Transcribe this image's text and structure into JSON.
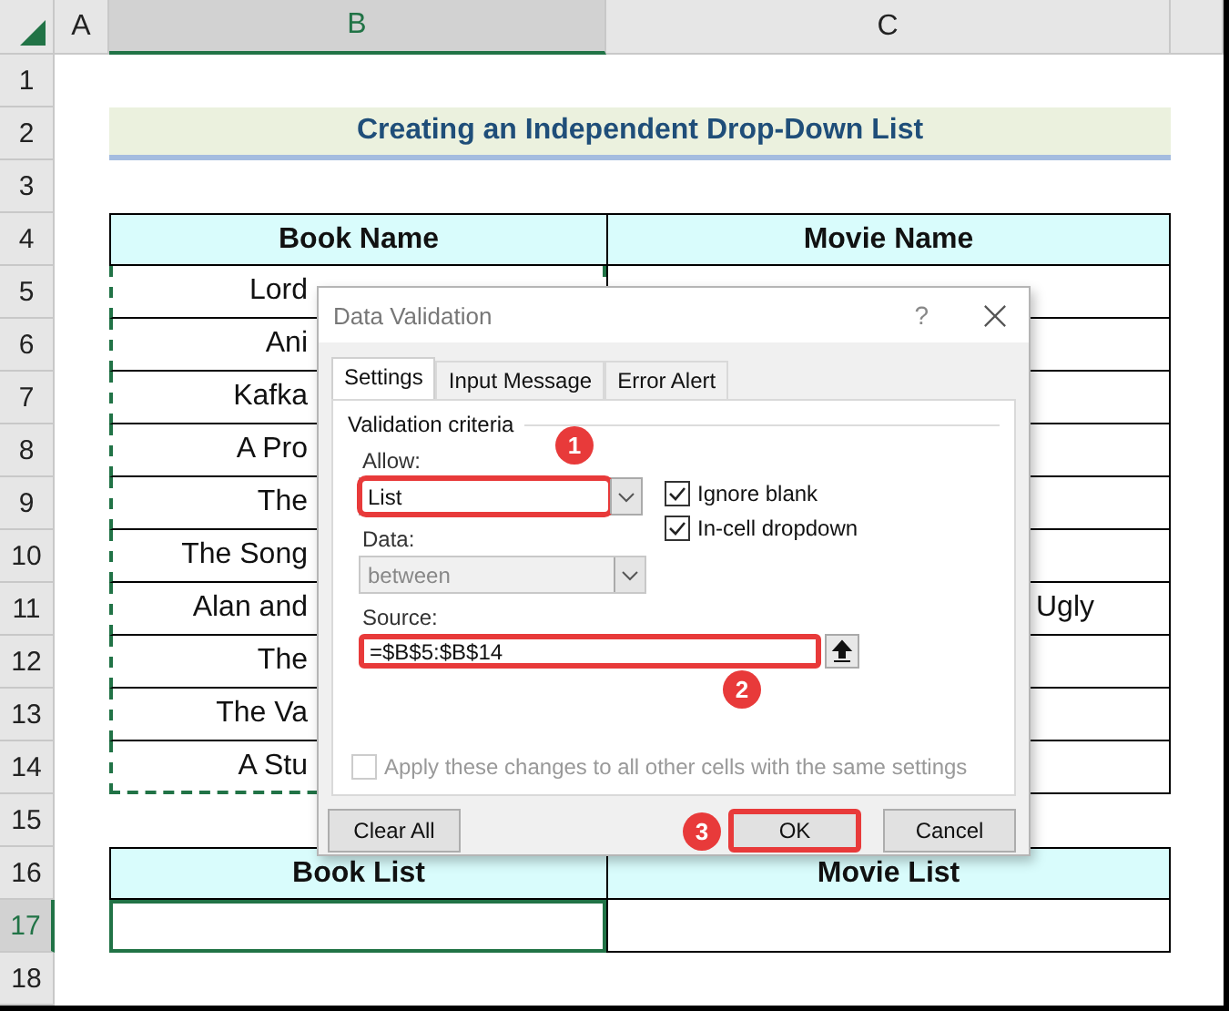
{
  "columns": [
    {
      "label": "A",
      "selected": false
    },
    {
      "label": "B",
      "selected": true
    },
    {
      "label": "C",
      "selected": false
    }
  ],
  "rows": [
    {
      "number": "1",
      "selected": false,
      "kind": "blank"
    },
    {
      "number": "2",
      "selected": false,
      "kind": "title",
      "text": "Creating an Independent Drop-Down List"
    },
    {
      "number": "3",
      "selected": false,
      "kind": "blank"
    },
    {
      "number": "4",
      "selected": false,
      "kind": "header",
      "cells": [
        "Book Name",
        "Movie Name"
      ]
    },
    {
      "number": "5",
      "selected": false,
      "kind": "data",
      "cells": [
        "Lord"
      ]
    },
    {
      "number": "6",
      "selected": false,
      "kind": "data",
      "cells": [
        "Ani"
      ]
    },
    {
      "number": "7",
      "selected": false,
      "kind": "data",
      "cells": [
        "Kafka"
      ]
    },
    {
      "number": "8",
      "selected": false,
      "kind": "data",
      "cells": [
        "A Pro"
      ]
    },
    {
      "number": "9",
      "selected": false,
      "kind": "data",
      "cells": [
        "The"
      ]
    },
    {
      "number": "10",
      "selected": false,
      "kind": "data",
      "cells": [
        "The Song"
      ]
    },
    {
      "number": "11",
      "selected": false,
      "kind": "data",
      "cells": [
        "Alan and",
        "Ugly"
      ]
    },
    {
      "number": "12",
      "selected": false,
      "kind": "data",
      "cells": [
        "The"
      ]
    },
    {
      "number": "13",
      "selected": false,
      "kind": "data",
      "cells": [
        "The Va"
      ]
    },
    {
      "number": "14",
      "selected": false,
      "kind": "data",
      "cells": [
        "A Stu"
      ]
    },
    {
      "number": "15",
      "selected": false,
      "kind": "blank"
    },
    {
      "number": "16",
      "selected": false,
      "kind": "header",
      "cells": [
        "Book List",
        "Movie List"
      ]
    },
    {
      "number": "17",
      "selected": true,
      "kind": "input"
    },
    {
      "number": "18",
      "selected": false,
      "kind": "blank"
    }
  ],
  "dialog": {
    "title": "Data Validation",
    "help": "?",
    "tabs": [
      {
        "label": "Settings",
        "selected": true
      },
      {
        "label": "Input Message",
        "selected": false
      },
      {
        "label": "Error Alert",
        "selected": false
      }
    ],
    "group": "Validation criteria",
    "allow": {
      "label": "Allow:",
      "value": "List",
      "badge": "1"
    },
    "data": {
      "label": "Data:",
      "value": "between",
      "disabled": true
    },
    "ignore_blank": {
      "label": "Ignore blank",
      "checked": true
    },
    "in_cell_dropdown": {
      "label": "In-cell dropdown",
      "checked": true
    },
    "source": {
      "label": "Source:",
      "value": "=$B$5:$B$14",
      "badge": "2"
    },
    "apply_all": {
      "label": "Apply these changes to all other cells with the same settings",
      "checked": false,
      "disabled": true
    },
    "buttons": {
      "clear": "Clear All",
      "ok": "OK",
      "cancel": "Cancel",
      "ok_badge": "3"
    }
  }
}
